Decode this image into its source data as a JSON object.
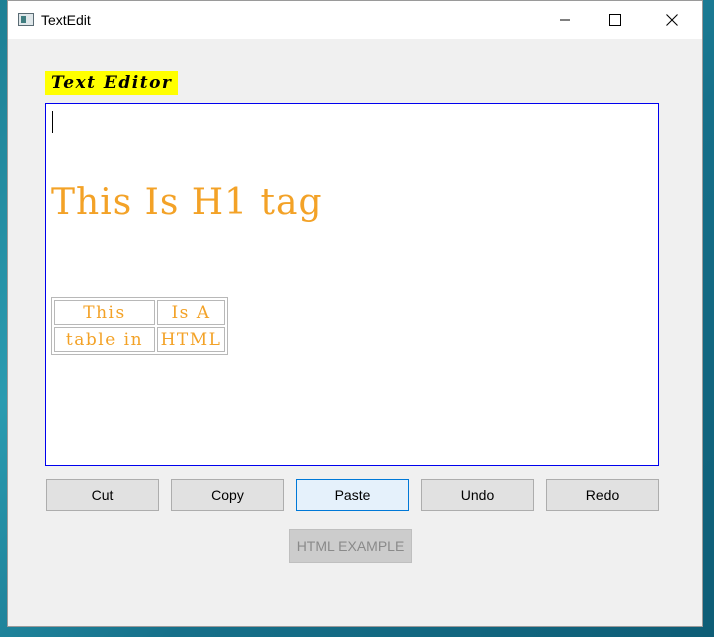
{
  "window": {
    "title": "TextEdit",
    "controls": [
      "minimize",
      "maximize",
      "close"
    ]
  },
  "heading_label": "Text Editor",
  "editor": {
    "h1_text": "This Is H1 tag",
    "table": [
      [
        "This",
        "Is A"
      ],
      [
        "table in",
        "HTML"
      ]
    ],
    "border_color": "#0000ee",
    "text_color": "#f3a227"
  },
  "buttons": {
    "cut": "Cut",
    "copy": "Copy",
    "paste": "Paste",
    "undo": "Undo",
    "redo": "Redo"
  },
  "html_example_button": "HTML EXAMPLE",
  "colors": {
    "heading_bg": "#ffff00",
    "accent_focus": "#0078d7"
  }
}
